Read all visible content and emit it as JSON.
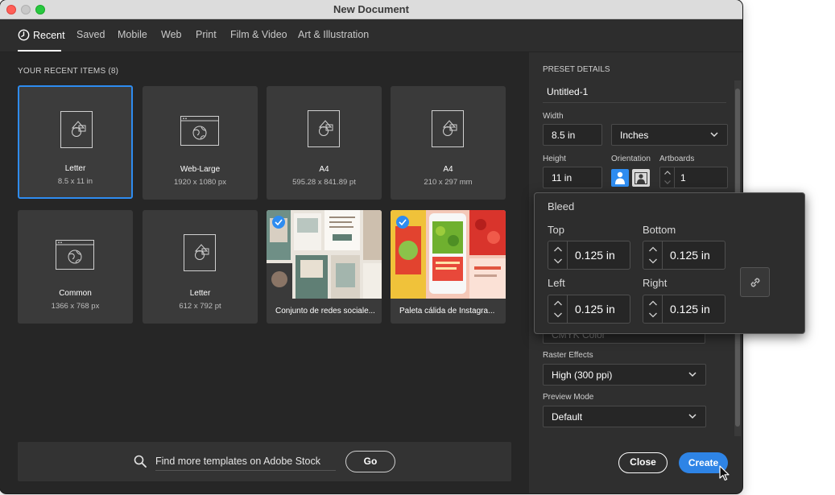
{
  "window": {
    "title": "New Document"
  },
  "tabs": [
    {
      "label": "Recent",
      "active": true
    },
    {
      "label": "Saved"
    },
    {
      "label": "Mobile"
    },
    {
      "label": "Web"
    },
    {
      "label": "Print"
    },
    {
      "label": "Film & Video"
    },
    {
      "label": "Art & Illustration"
    }
  ],
  "recent": {
    "title": "YOUR RECENT ITEMS  (8)",
    "items": [
      {
        "name": "Letter",
        "size": "8.5 x 11 in",
        "icon": "document-shapes-icon",
        "selected": true
      },
      {
        "name": "Web-Large",
        "size": "1920 x 1080 px",
        "icon": "web-globe-icon"
      },
      {
        "name": "A4",
        "size": "595.28 x 841.89 pt",
        "icon": "document-shapes-icon"
      },
      {
        "name": "A4",
        "size": "210 x 297 mm",
        "icon": "document-shapes-icon"
      },
      {
        "name": "Common",
        "size": "1366 x 768 px",
        "icon": "web-globe-icon"
      },
      {
        "name": "Letter",
        "size": "612 x 792 pt",
        "icon": "document-shapes-icon"
      },
      {
        "name": "Conjunto de redes sociale...",
        "type": "template"
      },
      {
        "name": "Paleta cálida de Instagra...",
        "type": "template"
      }
    ]
  },
  "search": {
    "text": "Find more templates on Adobe Stock",
    "go_label": "Go"
  },
  "preset": {
    "header": "PRESET DETAILS",
    "name": "Untitled-1",
    "width_label": "Width",
    "width_value": "8.5 in",
    "units": "Inches",
    "height_label": "Height",
    "height_value": "11 in",
    "orientation_label": "Orientation",
    "artboards_label": "Artboards",
    "artboards_value": "1",
    "color_mode_partial": "CMYK Color",
    "raster_label": "Raster Effects",
    "raster_value": "High (300 ppi)",
    "preview_label": "Preview Mode",
    "preview_value": "Default"
  },
  "bleed": {
    "title": "Bleed",
    "top_label": "Top",
    "top_value": "0.125 in",
    "bottom_label": "Bottom",
    "bottom_value": "0.125 in",
    "left_label": "Left",
    "left_value": "0.125 in",
    "right_label": "Right",
    "right_value": "0.125 in"
  },
  "actions": {
    "close_label": "Close",
    "create_label": "Create"
  },
  "colors": {
    "accent": "#2e8cf0",
    "create": "#2e84e6",
    "panel": "#2d2d2d"
  }
}
